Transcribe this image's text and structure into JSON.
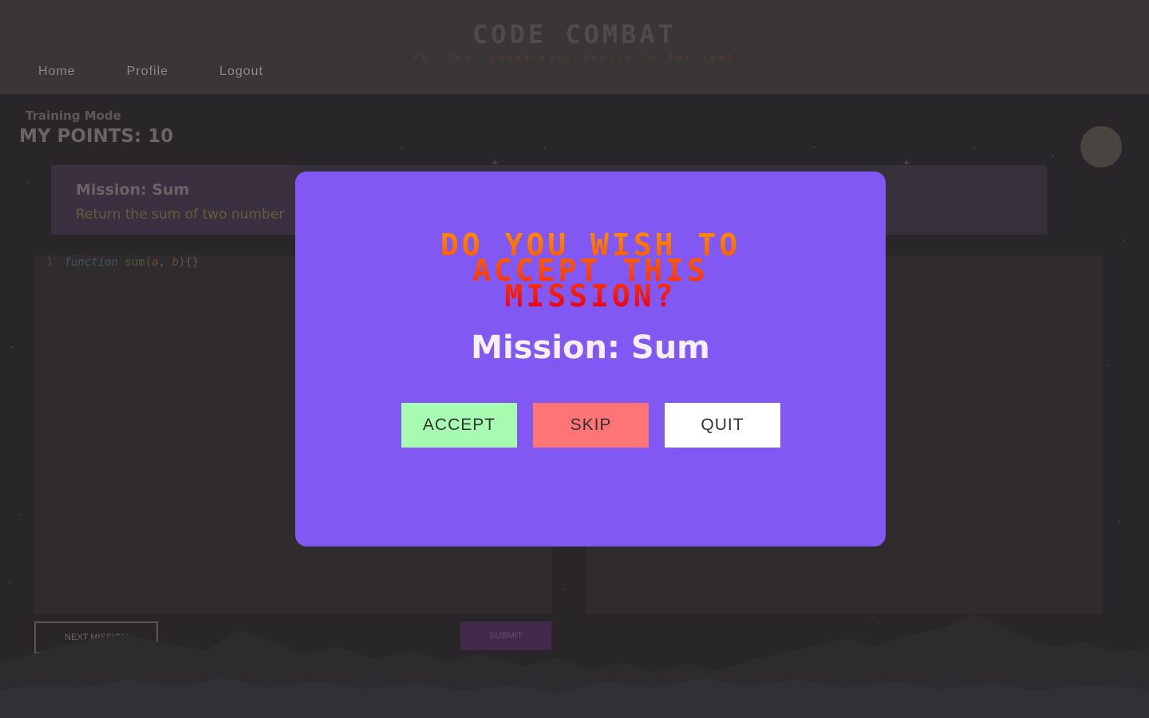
{
  "header": {
    "logo": "CODE COMBAT",
    "tagline": "Put Your JavaScript Skills To The Test",
    "nav": [
      "Home",
      "Profile",
      "Logout"
    ]
  },
  "status": {
    "mode": "Training Mode",
    "points": "MY POINTS: 10"
  },
  "mission_card": {
    "title": "Mission: Sum",
    "description": "Return the sum of two number"
  },
  "editor": {
    "line_number": "1",
    "keyword": "function",
    "fn_name": "sum",
    "open_paren": "(",
    "param_a": "a",
    "comma": ", ",
    "param_b": "b",
    "close": "){}"
  },
  "actions": {
    "next": "NEXT MISSION",
    "submit": "SUBMIT"
  },
  "modal": {
    "heading": "DO YOU WISH TO ACCEPT THIS MISSION?",
    "subtitle": "Mission: Sum",
    "accept": "ACCEPT",
    "skip": "SKIP",
    "quit": "QUIT"
  },
  "colors": {
    "modal_bg": "#8158f2",
    "accept_bg": "#a6fbb0",
    "skip_bg": "#ff7575",
    "quit_bg": "#ffffff"
  }
}
